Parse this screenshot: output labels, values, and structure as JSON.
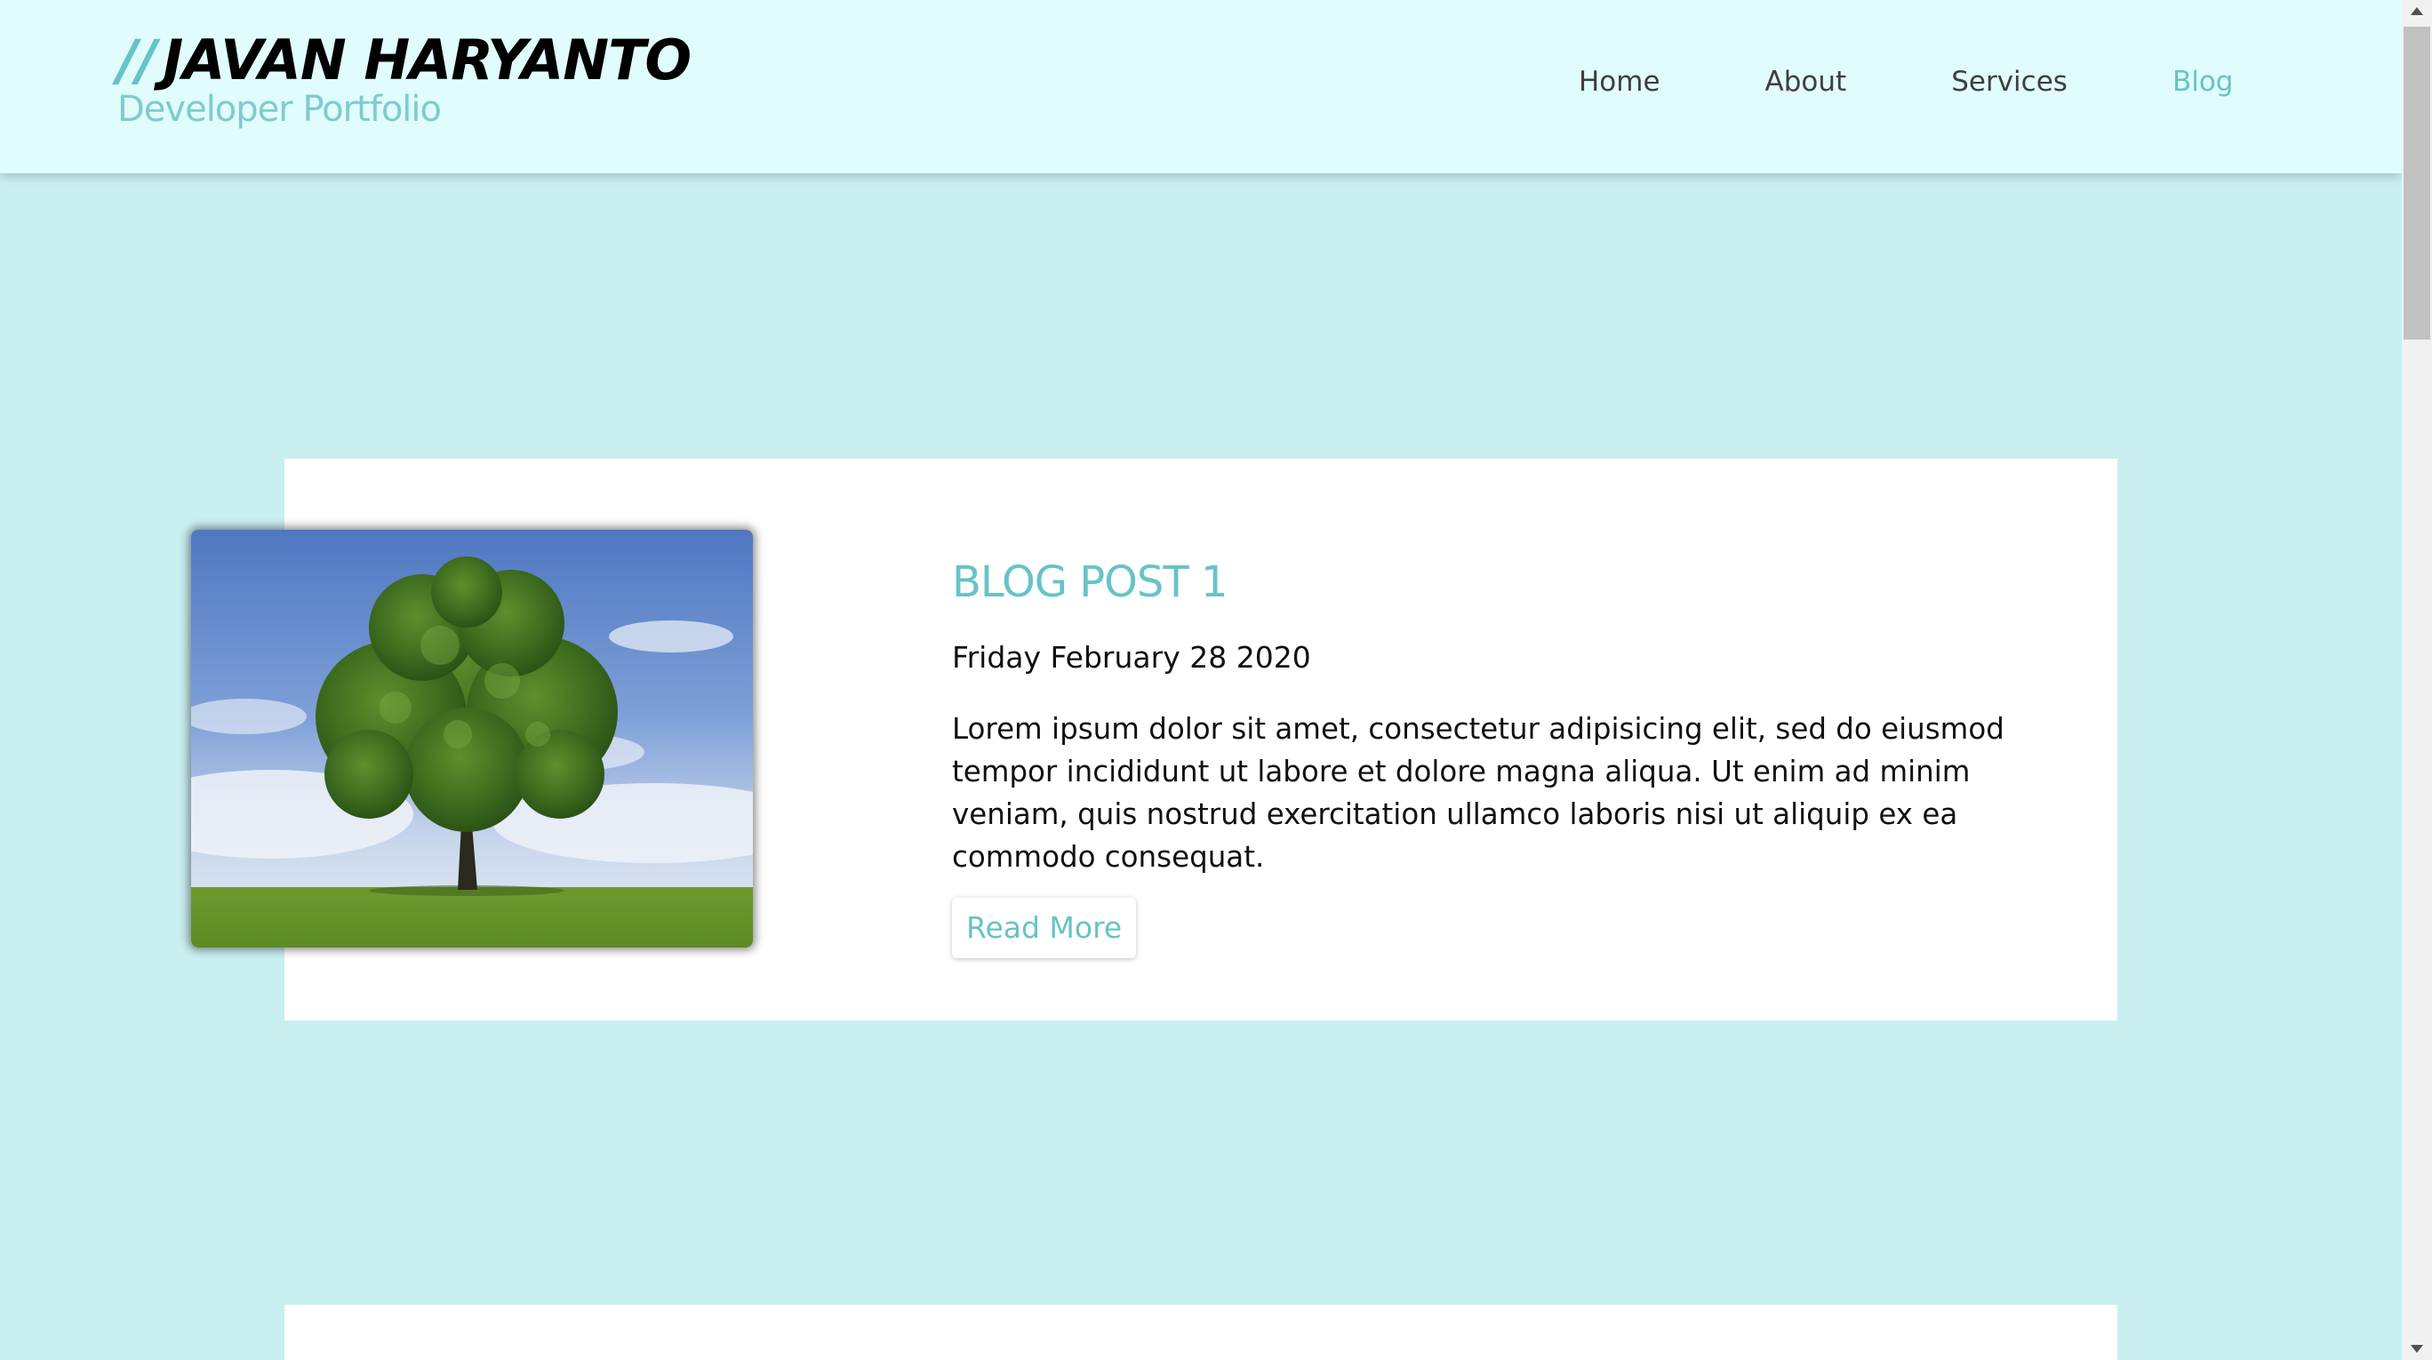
{
  "header": {
    "logo_slashes": "//",
    "logo_name": "JAVAN HARYANTO",
    "logo_subtitle": "Developer Portfolio",
    "nav": [
      {
        "label": "Home"
      },
      {
        "label": "About"
      },
      {
        "label": "Services"
      },
      {
        "label": "Blog",
        "active": true
      }
    ]
  },
  "posts": [
    {
      "title": "BLOG POST 1",
      "date": "Friday February 28 2020",
      "excerpt": "Lorem ipsum dolor sit amet, consectetur adipisicing elit, sed do eiusmod tempor incididunt ut labore et dolore magna aliqua. Ut enim ad minim veniam, quis nostrud exercitation ullamco laboris nisi ut aliquip ex ea commodo consequat.",
      "read_more": "Read More",
      "image": "tree-in-field-photo"
    }
  ],
  "colors": {
    "accent": "#67c3c6",
    "page_bg": "#c9eff1",
    "header_bg": "#e0fcfc"
  }
}
